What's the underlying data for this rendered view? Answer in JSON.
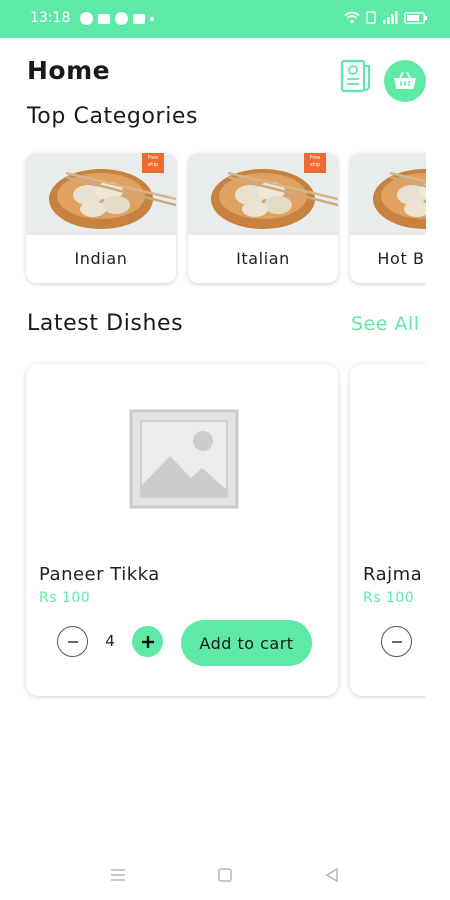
{
  "status_bar": {
    "time": "13:18"
  },
  "header": {
    "title": "Home"
  },
  "categories": {
    "title": "Top Categories",
    "badge": "Free ship",
    "items": [
      {
        "label": "Indian"
      },
      {
        "label": "Italian"
      },
      {
        "label": "Hot B"
      }
    ]
  },
  "dishes": {
    "title": "Latest Dishes",
    "see_all": "See All",
    "items": [
      {
        "name": "Paneer Tikka",
        "price": "Rs 100",
        "quantity": "4",
        "add_label": "Add to cart"
      },
      {
        "name": "Rajma",
        "price": "Rs 100"
      }
    ]
  },
  "colors": {
    "accent": "#5eeaa6",
    "badge": "#ef6a2f"
  }
}
